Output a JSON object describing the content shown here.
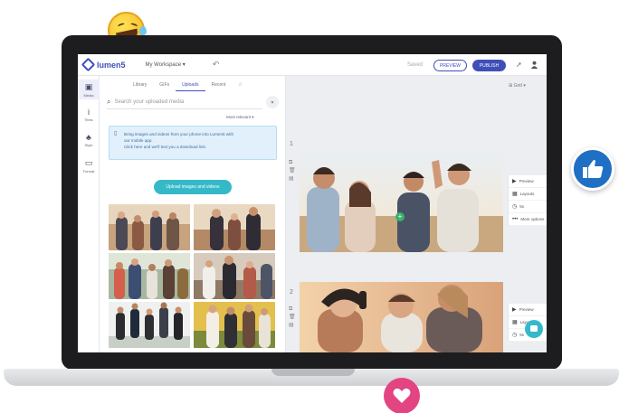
{
  "header": {
    "logo_text": "lumen5",
    "workspace": "My Workspace ▾",
    "undo_icon": "↶",
    "save_status": "Saved",
    "preview_label": "PREVIEW",
    "publish_label": "PUBLISH"
  },
  "rail": {
    "items": [
      {
        "label": "Media",
        "icon": "▣"
      },
      {
        "label": "Texts",
        "icon": "i"
      },
      {
        "label": "Style",
        "icon": "♣"
      },
      {
        "label": "Format",
        "icon": "▭"
      }
    ]
  },
  "media": {
    "tabs": [
      "Library",
      "GIFs",
      "Uploads",
      "Recent",
      "☆"
    ],
    "active_tab": "Uploads",
    "search_placeholder": "Search your uploaded media",
    "sort_label": "Most relevant ▾",
    "notice_line1": "Bring images and videos from your phone into Lumen5 with",
    "notice_line2": "our mobile app.",
    "notice_line3": "Click here and we'll text you a download link.",
    "upload_button": "Upload images and videos"
  },
  "canvas": {
    "layout_label": "⊞ Grid ▾",
    "scenes": [
      {
        "number": "1"
      },
      {
        "number": "2"
      }
    ],
    "scene_options": [
      "Preview",
      "Layouts",
      "5s",
      "More options"
    ]
  },
  "colors": {
    "brand": "#3f4fb8",
    "accent": "#35b9c9",
    "like_badge": "#1f6fc4",
    "heart_badge": "#e24581",
    "emoji": "#f3b51f"
  }
}
